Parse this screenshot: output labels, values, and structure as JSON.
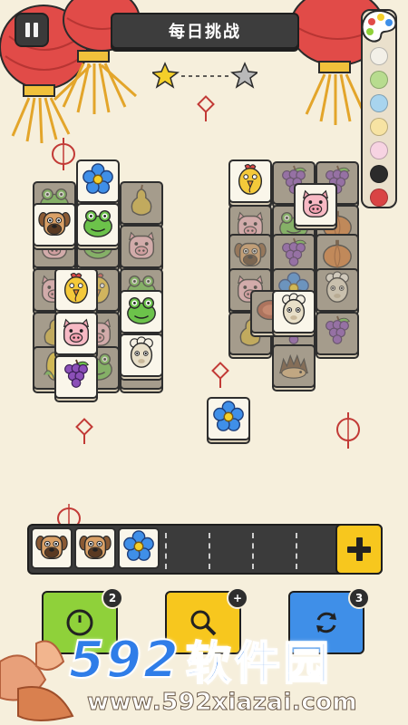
{
  "header": {
    "title": "每日挑战",
    "pause_icon": "pause-icon",
    "progress": {
      "current_star": "gold-star-icon",
      "target_star": "gray-star-icon",
      "completed_fraction": 0.0
    }
  },
  "palette": {
    "icon": "color-palette-icon",
    "swatches": [
      "#f3f0e8",
      "#b8dc8f",
      "#a8d4ee",
      "#f7e3a3",
      "#f7d3e2",
      "#2b2b2b",
      "#d94444"
    ]
  },
  "board": {
    "tile_types": [
      "flower",
      "frog",
      "pig",
      "chicken",
      "dog",
      "sheep",
      "grape",
      "corn",
      "meat",
      "hedgehog",
      "pumpkin",
      "pear"
    ],
    "top_tiles": [
      "flower",
      "dog",
      "frog",
      "chicken",
      "pig",
      "frog",
      "sheep",
      "grape",
      "chicken",
      "pig",
      "sheep",
      "flower"
    ]
  },
  "tray": {
    "capacity": 7,
    "slots": [
      "dog",
      "dog",
      "flower"
    ],
    "add_slot_icon": "plus-icon"
  },
  "boosters": [
    {
      "name": "undo",
      "icon": "undo-icon",
      "count": "2",
      "color": "#8fd13a"
    },
    {
      "name": "hint",
      "icon": "magnifier-icon",
      "count": "+",
      "color": "#f7c71e"
    },
    {
      "name": "shuffle",
      "icon": "shuffle-icon",
      "count": "3",
      "color": "#3f8fe8"
    }
  ],
  "watermark": {
    "logo_number": "592",
    "logo_text": "软件园",
    "url": "www.592xiazai.com"
  }
}
